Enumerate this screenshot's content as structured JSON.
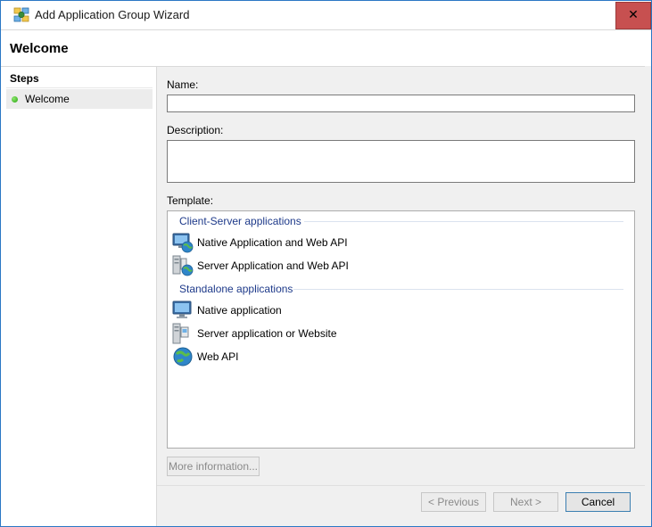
{
  "window": {
    "title": "Add Application Group Wizard",
    "close_glyph": "✕",
    "icon": "app-group-wizard-icon"
  },
  "header": {
    "title": "Welcome"
  },
  "steps": {
    "title": "Steps",
    "items": [
      {
        "label": "Welcome",
        "status": "current"
      }
    ]
  },
  "form": {
    "name_label": "Name:",
    "name_value": "",
    "description_label": "Description:",
    "description_value": "",
    "template_label": "Template:"
  },
  "template": {
    "groups": [
      {
        "header": "Client-Server applications",
        "items": [
          {
            "label": "Native Application and Web API",
            "icon": "native-app-web-api-icon"
          },
          {
            "label": "Server Application and Web API",
            "icon": "server-app-web-api-icon"
          }
        ]
      },
      {
        "header": "Standalone applications",
        "items": [
          {
            "label": "Native application",
            "icon": "native-application-icon"
          },
          {
            "label": "Server application or Website",
            "icon": "server-application-icon"
          },
          {
            "label": "Web API",
            "icon": "web-api-icon"
          }
        ]
      }
    ]
  },
  "buttons": {
    "more_info": "More information...",
    "previous": "< Previous",
    "next": "Next >",
    "cancel": "Cancel"
  },
  "colors": {
    "close_button": "#c75050",
    "group_header": "#1e3a8a",
    "step_active": "#27a30f",
    "content_bg": "#f0f0f0"
  }
}
